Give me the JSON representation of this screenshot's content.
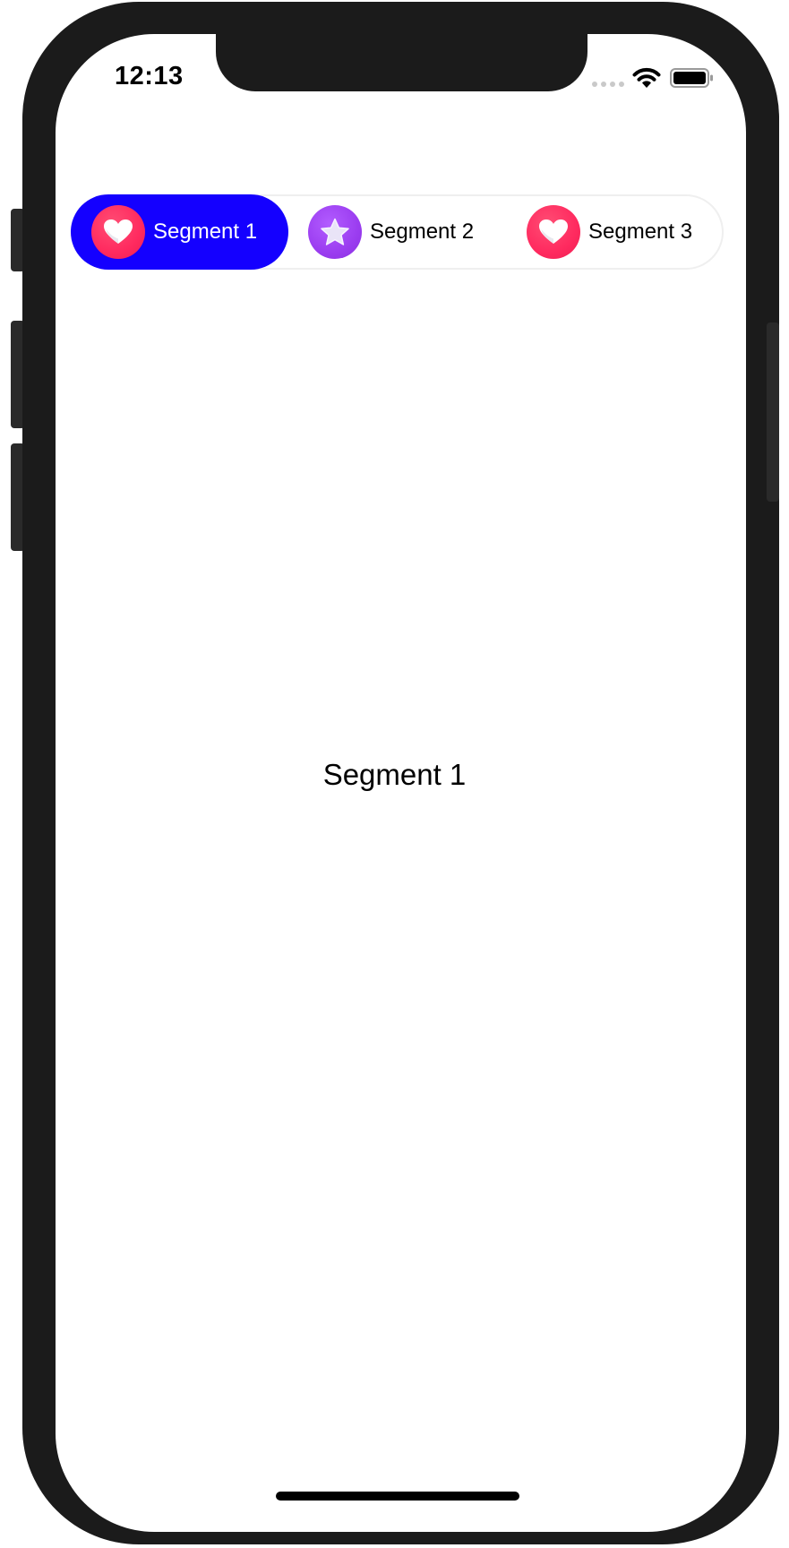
{
  "status_bar": {
    "time": "12:13",
    "icons": [
      "cellular-signal-icon",
      "wifi-icon",
      "battery-icon"
    ]
  },
  "segmented_control": {
    "selected_index": 0,
    "selected_color": "#1400ff",
    "segments": [
      {
        "label": "Segment 1",
        "icon": "heart-icon",
        "icon_bg": "#ff2a5f"
      },
      {
        "label": "Segment 2",
        "icon": "star-icon",
        "icon_bg": "#9b3df0"
      },
      {
        "label": "Segment 3",
        "icon": "heart-icon",
        "icon_bg": "#ff2a5f"
      }
    ]
  },
  "content": {
    "label": "Segment 1"
  }
}
